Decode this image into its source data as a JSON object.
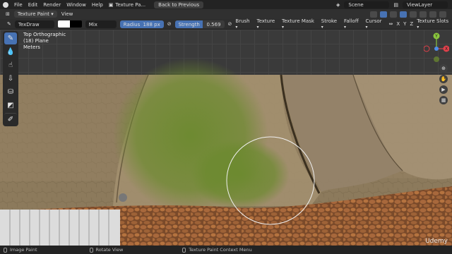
{
  "menubar": {
    "items": [
      "File",
      "Edit",
      "Render",
      "Window",
      "Help"
    ],
    "workspace": "Texture Pa...",
    "back_button": "Back to Previous",
    "scene": "Scene",
    "view_layer": "ViewLayer"
  },
  "header": {
    "mode": "Texture Paint",
    "view_menu": "View"
  },
  "tool_settings": {
    "brush_name": "TexDraw",
    "primary_color": "#ffffff",
    "secondary_color": "#000000",
    "blend_mode": "Mix",
    "radius": {
      "label": "Radius",
      "value": "188 px"
    },
    "strength": {
      "label": "Strength",
      "value": "0.569",
      "fill": 0.569
    },
    "menus": [
      "Brush",
      "Texture",
      "Texture Mask",
      "Stroke",
      "Falloff",
      "Cursor"
    ],
    "axes": [
      "X",
      "Y",
      "Z"
    ],
    "texture_slots": "Texture Slots"
  },
  "viewport_info": {
    "line1": "Top Orthographic",
    "line2": "(18) Plane",
    "line3": "Meters"
  },
  "gizmo": {
    "y_label": "Y",
    "x_label": "X",
    "z_label": "Z",
    "colors": {
      "x": "#e0414b",
      "y": "#8bc63e",
      "z": "#4f8ee8"
    }
  },
  "toolbar": {
    "tools": [
      "draw-brush-icon",
      "soften-brush-icon",
      "smear-brush-icon",
      "clone-brush-icon",
      "fill-brush-icon",
      "mask-brush-icon",
      "annotate-icon"
    ]
  },
  "status_bar": {
    "left": "Image Paint",
    "middle": "Rotate View",
    "right": "Texture Paint Context Menu"
  },
  "watermark": "Udemy",
  "accent": "#4772b3"
}
